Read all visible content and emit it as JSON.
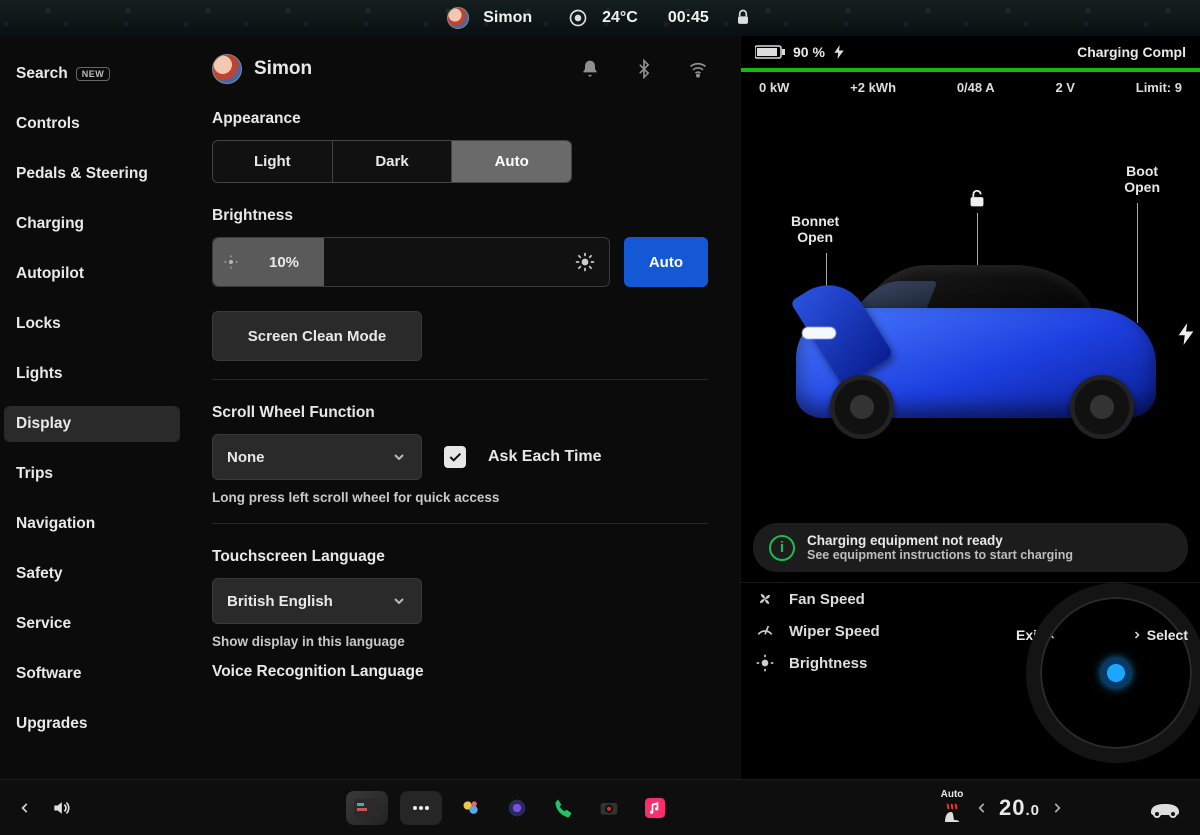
{
  "topbar": {
    "profile_name": "Simon",
    "temperature": "24°C",
    "clock": "00:45"
  },
  "sidebar": {
    "items": [
      {
        "label": "Search",
        "badge": "NEW"
      },
      {
        "label": "Controls"
      },
      {
        "label": "Pedals & Steering"
      },
      {
        "label": "Charging"
      },
      {
        "label": "Autopilot"
      },
      {
        "label": "Locks"
      },
      {
        "label": "Lights"
      },
      {
        "label": "Display",
        "active": true
      },
      {
        "label": "Trips"
      },
      {
        "label": "Navigation"
      },
      {
        "label": "Safety"
      },
      {
        "label": "Service"
      },
      {
        "label": "Software"
      },
      {
        "label": "Upgrades"
      }
    ]
  },
  "settings": {
    "profile_name": "Simon",
    "appearance": {
      "title": "Appearance",
      "options": [
        "Light",
        "Dark",
        "Auto"
      ],
      "selected": "Auto"
    },
    "brightness": {
      "title": "Brightness",
      "value_label": "10%",
      "auto_label": "Auto"
    },
    "screen_clean_label": "Screen Clean Mode",
    "scroll": {
      "title": "Scroll Wheel Function",
      "value": "None",
      "ask_label": "Ask Each Time",
      "ask_checked": true,
      "hint": "Long press left scroll wheel for quick access"
    },
    "lang": {
      "title": "Touchscreen Language",
      "value": "British English",
      "hint": "Show display in this language"
    },
    "voice": {
      "title": "Voice Recognition Language"
    }
  },
  "charging": {
    "battery_pct": "90 %",
    "header": "Charging Compl",
    "stats": {
      "power": "0 kW",
      "energy": "+2 kWh",
      "amps": "0/48 A",
      "volts": "2 V",
      "limit": "Limit: 9"
    },
    "labels": {
      "bonnet": "Bonnet\nOpen",
      "boot": "Boot\nOpen"
    },
    "alert": {
      "line1": "Charging equipment not ready",
      "line2": "See equipment instructions to start charging"
    },
    "quick": {
      "fan": "Fan Speed",
      "wiper": "Wiper Speed",
      "brightness": "Brightness",
      "exit": "Exit",
      "select": "Select"
    }
  },
  "dock": {
    "seat_mode": "Auto",
    "temp_whole": "20",
    "temp_dec": ".0"
  }
}
